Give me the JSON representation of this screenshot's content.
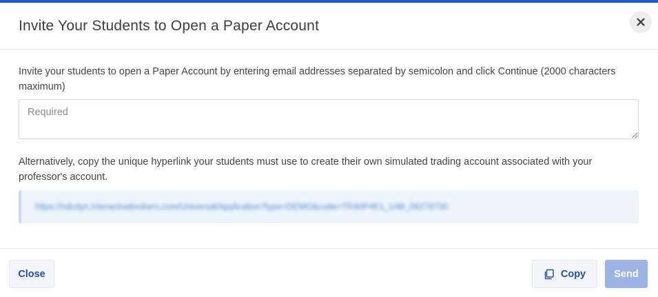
{
  "dialog": {
    "title": "Invite Your Students to Open a Paper Account",
    "close_icon": "close-x-icon"
  },
  "invite": {
    "instructions": "Invite your students to open a Paper Account by entering email addresses separated by semicolon and click Continue (2000 characters maximum)",
    "email_placeholder": "Required"
  },
  "link": {
    "description": "Alternatively, copy the unique hyperlink your students must use to create their own simulated trading account associated with your professor's account.",
    "url": "https://ndcdyn.interactivebrokers.com/Universal/Application?type=DEMO&code=TR40P4K1_U48_09278730"
  },
  "footer": {
    "close_label": "Close",
    "copy_label": "Copy",
    "copy_icon": "copy-icon",
    "send_label": "Send"
  },
  "colors": {
    "accent": "#1c58c9",
    "button_text": "#1f4fa8",
    "send_disabled": "#9cb3e6",
    "link_bg": "#eef4fb"
  }
}
